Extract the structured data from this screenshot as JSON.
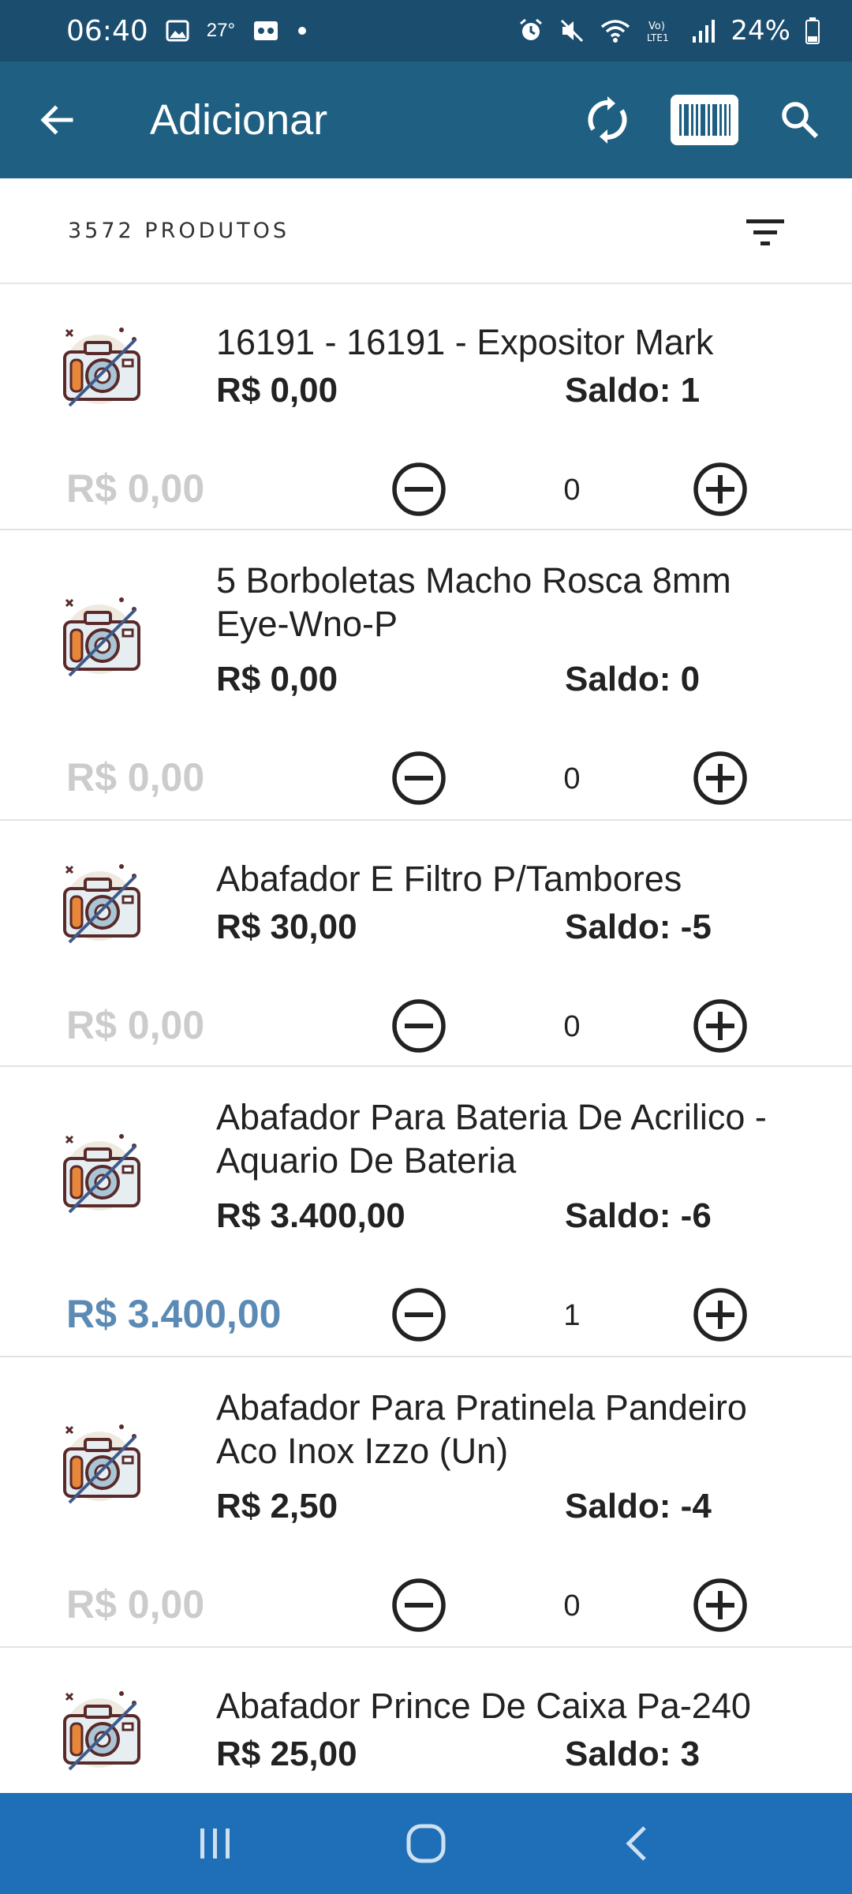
{
  "status_bar": {
    "time": "06:40",
    "temperature": "27°",
    "battery": "24%"
  },
  "app_bar": {
    "title": "Adicionar"
  },
  "list_header": {
    "count": "3572 PRODUTOS"
  },
  "products": [
    {
      "name": "16191 - 16191 - Expositor Mark",
      "price": "R$ 0,00",
      "saldo": "Saldo: 1",
      "subtotal": "R$ 0,00",
      "qty": "0"
    },
    {
      "name": "5 Borboletas Macho Rosca 8mm Eye-Wno-P",
      "price": "R$ 0,00",
      "saldo": "Saldo: 0",
      "subtotal": "R$ 0,00",
      "qty": "0"
    },
    {
      "name": "Abafador E Filtro P/Tambores",
      "price": "R$ 30,00",
      "saldo": "Saldo: -5",
      "subtotal": "R$ 0,00",
      "qty": "0"
    },
    {
      "name": "Abafador Para Bateria De Acrilico - Aquario De Bateria",
      "price": "R$ 3.400,00",
      "saldo": "Saldo: -6",
      "subtotal": "R$ 3.400,00",
      "qty": "1"
    },
    {
      "name": "Abafador Para Pratinela Pandeiro Aco Inox Izzo   (Un)",
      "price": "R$ 2,50",
      "saldo": "Saldo: -4",
      "subtotal": "R$ 0,00",
      "qty": "0"
    },
    {
      "name": "Abafador Prince De Caixa Pa-240",
      "price": "R$ 25,00",
      "saldo": "Saldo: 3"
    }
  ],
  "colors": {
    "status_bar": "#1a4d6e",
    "app_bar": "#1f5f82",
    "nav_bar": "#1f6fb8",
    "subtotal_inactive": "#cccccc",
    "subtotal_active": "#5b8ab5"
  },
  "icons": {
    "back": "arrow-left-icon",
    "sync": "sync-icon",
    "barcode": "barcode-icon",
    "search": "search-icon",
    "filter": "filter-icon",
    "no_image": "no-photo-camera-icon",
    "minus": "minus-circle-icon",
    "plus": "plus-circle-icon"
  }
}
